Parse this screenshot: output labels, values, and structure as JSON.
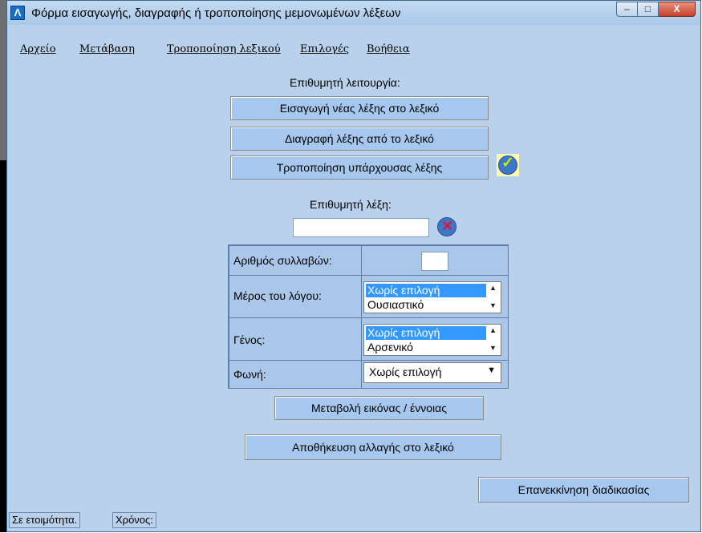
{
  "window": {
    "title": "Φόρμα εισαγωγής, διαγραφής ή τροποποίησης μεμονωμένων λέξεων",
    "app_icon_glyph": "Λ",
    "controls": {
      "minimize": "–",
      "maximize": "□",
      "close": "X"
    }
  },
  "menubar": {
    "items": [
      {
        "label": "Αρχείο"
      },
      {
        "label": "Μετάβαση"
      },
      {
        "label": "Τροποποίηση λεξικού"
      },
      {
        "label": "Επιλογές"
      },
      {
        "label": "Βοήθεια"
      }
    ]
  },
  "operation": {
    "heading": "Επιθυμητή λειτουργία:",
    "insert_label": "Εισαγωγή νέας λέξης στο λεξικό",
    "delete_label": "Διαγραφή λέξης από το λεξικό",
    "modify_label": "Τροποποίηση υπάρχουσας λέξης",
    "selected_icon": "checkmark-icon"
  },
  "word": {
    "heading": "Επιθυμητή λέξη:",
    "value": "",
    "clear_icon": "x-circle-icon"
  },
  "properties": {
    "syllables_label": "Αριθμός συλλαβών:",
    "syllables_value": "",
    "part_of_speech_label": "Μέρος του λόγου:",
    "part_of_speech_options": [
      "Χωρίς επιλογή",
      "Ουσιαστικό"
    ],
    "gender_label": "Γένος:",
    "gender_options": [
      "Χωρίς επιλογή",
      "Αρσενικό"
    ],
    "voice_label": "Φωνή:",
    "voice_value": "Χωρίς επιλογή"
  },
  "actions": {
    "change_image_label": "Μεταβολή εικόνας / έννοιας",
    "save_label": "Αποθήκευση αλλαγής στο λεξικό",
    "restart_label": "Επανεκκίνηση διαδικασίας"
  },
  "statusbar": {
    "ready": "Σε ετοιμότητα.",
    "time_label": "Χρόνος:"
  },
  "colors": {
    "window_background": "#b9d1ea",
    "button_background": "#a6c8ee",
    "selection": "#3399ff"
  }
}
